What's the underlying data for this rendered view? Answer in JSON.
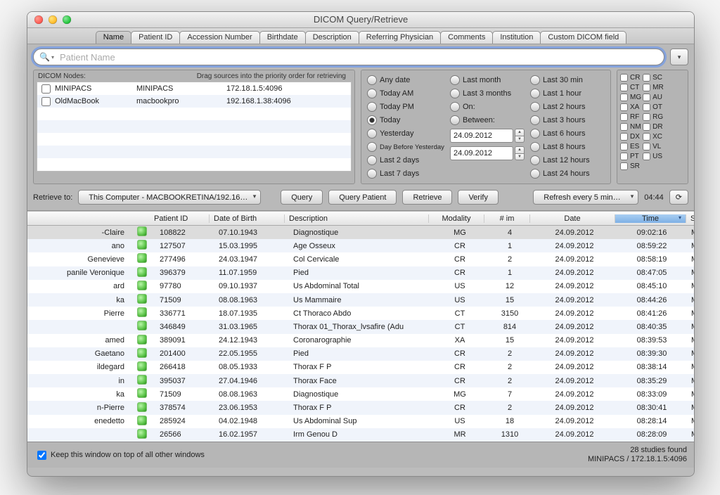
{
  "window": {
    "title": "DICOM Query/Retrieve"
  },
  "tabs": [
    "Name",
    "Patient ID",
    "Accession Number",
    "Birthdate",
    "Description",
    "Referring Physician",
    "Comments",
    "Institution",
    "Custom DICOM field"
  ],
  "active_tab": 0,
  "search": {
    "placeholder": "Patient Name"
  },
  "nodes": {
    "header_left": "DICOM Nodes:",
    "header_right": "Drag sources into the priority order for retrieving",
    "items": [
      {
        "name": "MINIPACS",
        "aet": "MINIPACS",
        "addr": "172.18.1.5:4096"
      },
      {
        "name": "OldMacBook",
        "aet": "macbookpro",
        "addr": "192.168.1.38:4096"
      }
    ]
  },
  "dates": {
    "col1": [
      "Any date",
      "Today AM",
      "Today PM",
      "Today",
      "Yesterday",
      "Day Before Yesterday",
      "Last 2 days",
      "Last 7 days"
    ],
    "col1_selected": 3,
    "col2": [
      "Last month",
      "Last 3 months",
      "On:",
      "Between:"
    ],
    "from": "24.09.2012",
    "to": "24.09.2012",
    "col3": [
      "Last 30 min",
      "Last 1 hour",
      "Last 2 hours",
      "Last 3 hours",
      "Last 6 hours",
      "Last 8 hours",
      "Last 12 hours",
      "Last 24 hours"
    ]
  },
  "modalities": {
    "col1": [
      "CR",
      "CT",
      "MG",
      "XA",
      "RF",
      "NM",
      "DX",
      "ES",
      "PT",
      "SR"
    ],
    "col2": [
      "SC",
      "MR",
      "AU",
      "OT",
      "RG",
      "DR",
      "XC",
      "VL",
      "US"
    ]
  },
  "actions": {
    "retrieve_to_label": "Retrieve to:",
    "retrieve_to": "This Computer - MACBOOKRETINA/192.16…",
    "query": "Query",
    "query_patient": "Query Patient",
    "retrieve": "Retrieve",
    "verify": "Verify",
    "refresh": "Refresh every 5 min…",
    "clock": "04:44"
  },
  "columns": [
    "",
    "",
    "Patient ID",
    "Date of Birth",
    "Description",
    "Modality",
    "# im",
    "Date",
    "Time",
    "Source"
  ],
  "rows": [
    {
      "name": "-Claire",
      "pid": "108822",
      "dob": "07.10.1943",
      "desc": "Diagnostique",
      "mod": "MG",
      "nim": "4",
      "date": "24.09.2012",
      "time": "09:02:16",
      "src": "MINIPACS",
      "sel": true
    },
    {
      "name": "ano",
      "pid": "127507",
      "dob": "15.03.1995",
      "desc": "Age Osseux",
      "mod": "CR",
      "nim": "1",
      "date": "24.09.2012",
      "time": "08:59:22",
      "src": "MINIPACS"
    },
    {
      "name": "Genevieve",
      "pid": "277496",
      "dob": "24.03.1947",
      "desc": "Col Cervicale",
      "mod": "CR",
      "nim": "2",
      "date": "24.09.2012",
      "time": "08:58:19",
      "src": "MINIPACS"
    },
    {
      "name": "panile Veronique",
      "pid": "396379",
      "dob": "11.07.1959",
      "desc": "Pied",
      "mod": "CR",
      "nim": "1",
      "date": "24.09.2012",
      "time": "08:47:05",
      "src": "MINIPACS"
    },
    {
      "name": "ard",
      "pid": "97780",
      "dob": "09.10.1937",
      "desc": "Us Abdominal Total",
      "mod": "US",
      "nim": "12",
      "date": "24.09.2012",
      "time": "08:45:10",
      "src": "MINIPACS"
    },
    {
      "name": "ka",
      "pid": "71509",
      "dob": "08.08.1963",
      "desc": "Us Mammaire",
      "mod": "US",
      "nim": "15",
      "date": "24.09.2012",
      "time": "08:44:26",
      "src": "MINIPACS"
    },
    {
      "name": " Pierre",
      "pid": "336771",
      "dob": "18.07.1935",
      "desc": "Ct Thoraco Abdo",
      "mod": "CT",
      "nim": "3150",
      "date": "24.09.2012",
      "time": "08:41:26",
      "src": "MINIPACS"
    },
    {
      "name": "",
      "pid": "346849",
      "dob": "31.03.1965",
      "desc": "Thorax 01_Thorax_lvsafire (Adu",
      "mod": "CT",
      "nim": "814",
      "date": "24.09.2012",
      "time": "08:40:35",
      "src": "MINIPACS"
    },
    {
      "name": "amed",
      "pid": "389091",
      "dob": "24.12.1943",
      "desc": "Coronarographie",
      "mod": "XA",
      "nim": "15",
      "date": "24.09.2012",
      "time": "08:39:53",
      "src": "MINIPACS"
    },
    {
      "name": "Gaetano",
      "pid": "201400",
      "dob": "22.05.1955",
      "desc": "Pied",
      "mod": "CR",
      "nim": "2",
      "date": "24.09.2012",
      "time": "08:39:30",
      "src": "MINIPACS"
    },
    {
      "name": "ildegard",
      "pid": "266418",
      "dob": "08.05.1933",
      "desc": "Thorax F P",
      "mod": "CR",
      "nim": "2",
      "date": "24.09.2012",
      "time": "08:38:14",
      "src": "MINIPACS"
    },
    {
      "name": "in",
      "pid": "395037",
      "dob": "27.04.1946",
      "desc": "Thorax Face",
      "mod": "CR",
      "nim": "2",
      "date": "24.09.2012",
      "time": "08:35:29",
      "src": "MINIPACS"
    },
    {
      "name": "ka",
      "pid": "71509",
      "dob": "08.08.1963",
      "desc": "Diagnostique",
      "mod": "MG",
      "nim": "7",
      "date": "24.09.2012",
      "time": "08:33:09",
      "src": "MINIPACS"
    },
    {
      "name": "n-Pierre",
      "pid": "378574",
      "dob": "23.06.1953",
      "desc": "Thorax F P",
      "mod": "CR",
      "nim": "2",
      "date": "24.09.2012",
      "time": "08:30:41",
      "src": "MINIPACS"
    },
    {
      "name": "enedetto",
      "pid": "285924",
      "dob": "04.02.1948",
      "desc": "Us Abdominal Sup",
      "mod": "US",
      "nim": "18",
      "date": "24.09.2012",
      "time": "08:28:14",
      "src": "MINIPACS"
    },
    {
      "name": "",
      "pid": "26566",
      "dob": "16.02.1957",
      "desc": "Irm Genou D",
      "mod": "MR",
      "nim": "1310",
      "date": "24.09.2012",
      "time": "08:28:09",
      "src": "MINIPACS"
    }
  ],
  "footer": {
    "keep_on_top": "Keep this window on top of all other windows",
    "studies_found": "28 studies found",
    "source_info": "MINIPACS  /  172.18.1.5:4096"
  }
}
